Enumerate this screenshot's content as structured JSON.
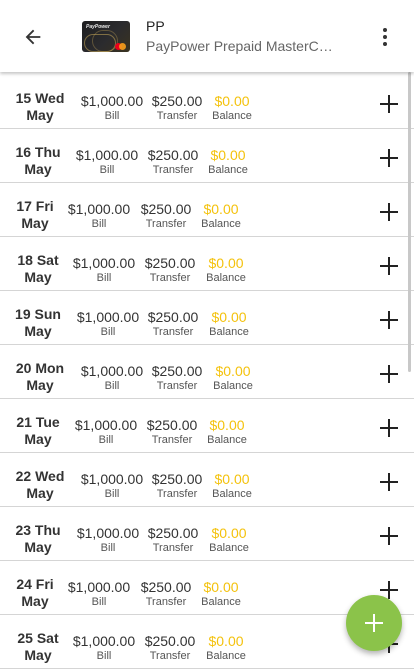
{
  "header": {
    "title": "PP",
    "subtitle": "PayPower Prepaid MasterCard",
    "card_brand": "PayPower",
    "icons": {
      "back": "arrow-back-icon",
      "menu": "more-vert-icon"
    }
  },
  "labels": {
    "bill": "Bill",
    "transfer": "Transfer",
    "balance": "Balance"
  },
  "colors": {
    "balance": "#f4c20d",
    "fab": "#8bc34a"
  },
  "rows": [
    {
      "date_line1": "15 Wed",
      "date_line2": "May",
      "bill": "$1,000.00",
      "transfer": "$250.00",
      "balance": "$0.00"
    },
    {
      "date_line1": "16 Thu",
      "date_line2": "May",
      "bill": "$1,000.00",
      "transfer": "$250.00",
      "balance": "$0.00"
    },
    {
      "date_line1": "17 Fri",
      "date_line2": "May",
      "bill": "$1,000.00",
      "transfer": "$250.00",
      "balance": "$0.00"
    },
    {
      "date_line1": "18 Sat",
      "date_line2": "May",
      "bill": "$1,000.00",
      "transfer": "$250.00",
      "balance": "$0.00"
    },
    {
      "date_line1": "19 Sun",
      "date_line2": "May",
      "bill": "$1,000.00",
      "transfer": "$250.00",
      "balance": "$0.00"
    },
    {
      "date_line1": "20 Mon",
      "date_line2": "May",
      "bill": "$1,000.00",
      "transfer": "$250.00",
      "balance": "$0.00"
    },
    {
      "date_line1": "21 Tue",
      "date_line2": "May",
      "bill": "$1,000.00",
      "transfer": "$250.00",
      "balance": "$0.00"
    },
    {
      "date_line1": "22 Wed",
      "date_line2": "May",
      "bill": "$1,000.00",
      "transfer": "$250.00",
      "balance": "$0.00"
    },
    {
      "date_line1": "23 Thu",
      "date_line2": "May",
      "bill": "$1,000.00",
      "transfer": "$250.00",
      "balance": "$0.00"
    },
    {
      "date_line1": "24 Fri",
      "date_line2": "May",
      "bill": "$1,000.00",
      "transfer": "$250.00",
      "balance": "$0.00"
    },
    {
      "date_line1": "25 Sat",
      "date_line2": "May",
      "bill": "$1,000.00",
      "transfer": "$250.00",
      "balance": "$0.00"
    }
  ]
}
